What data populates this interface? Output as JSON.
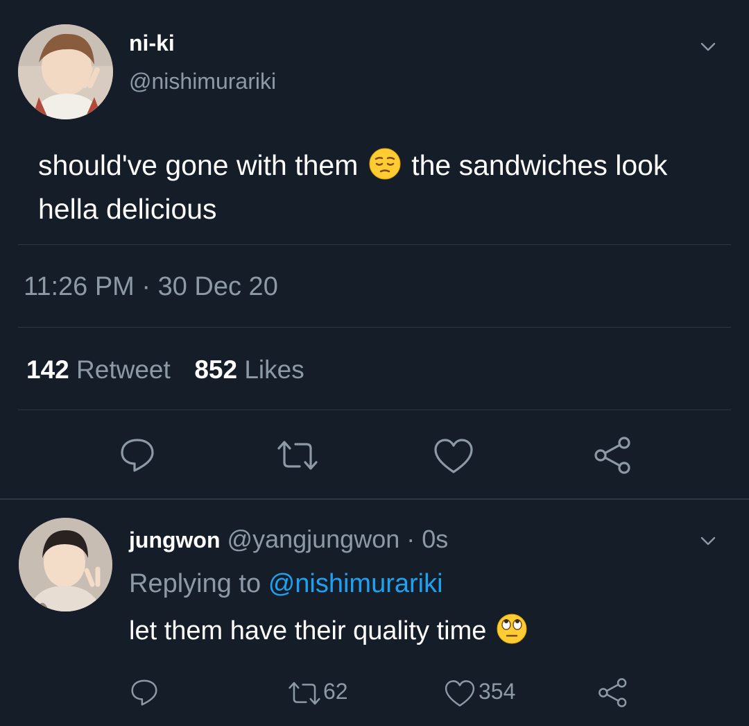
{
  "tweet": {
    "author": {
      "display_name": "ni-ki",
      "handle": "@nishimurariki"
    },
    "text_part1": "should've gone with them",
    "emoji1": "pensive-face-emoji",
    "text_part2": "the sandwiches look hella delicious",
    "timestamp": "11:26 PM · 30 Dec 20",
    "retweet_count": "142",
    "retweet_label": "Retweet",
    "like_count": "852",
    "like_label": "Likes",
    "actions": [
      "reply-icon",
      "retweet-icon",
      "like-icon",
      "share-icon"
    ]
  },
  "reply": {
    "author": {
      "display_name": "jungwon",
      "handle": "@yangjungwon",
      "time": "· 0s"
    },
    "replying_label": "Replying to",
    "replying_to": "@nishimurariki",
    "text": "let them have their quality time",
    "emoji": "face-with-rolling-eyes-emoji",
    "retweet_count": "62",
    "like_count": "354"
  },
  "colors": {
    "background": "#151e28",
    "secondary_text": "#8d9aa6",
    "link": "#1da1f2",
    "divider": "#2c3844"
  }
}
